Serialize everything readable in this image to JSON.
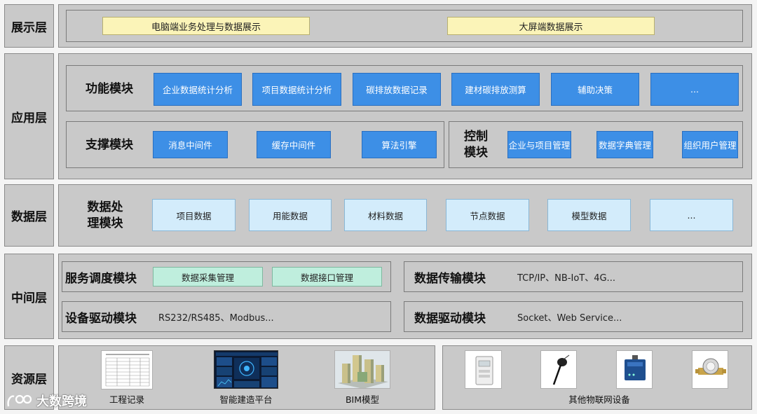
{
  "layers": {
    "display": "展示层",
    "application": "应用层",
    "data": "数据层",
    "middle": "中间层",
    "resource": "资源层"
  },
  "display": {
    "items": [
      "电脑端业务处理与数据展示",
      "大屏端数据展示"
    ]
  },
  "application": {
    "function_title": "功能模块",
    "function_items": [
      "企业数据统计分析",
      "项目数据统计分析",
      "碳排放数据记录",
      "建材碳排放测算",
      "辅助决策",
      "..."
    ],
    "support_title": "支撑模块",
    "support_items": [
      "消息中间件",
      "缓存中间件",
      "算法引擎"
    ],
    "control_title_1": "控制",
    "control_title_2": "模块",
    "control_items": [
      "企业与项目管理",
      "数据字典管理",
      "组织用户管理"
    ]
  },
  "data_layer": {
    "title_1": "数据处",
    "title_2": "理模块",
    "items": [
      "项目数据",
      "用能数据",
      "材料数据",
      "节点数据",
      "模型数据",
      "..."
    ]
  },
  "middle": {
    "scheduling_title": "服务调度模块",
    "scheduling_items": [
      "数据采集管理",
      "数据接口管理"
    ],
    "transfer_title": "数据传输模块",
    "transfer_text": "TCP/IP、NB-IoT、4G...",
    "device_title": "设备驱动模块",
    "device_text": "RS232/RS485、Modbus...",
    "datadrv_title": "数据驱动模块",
    "datadrv_text": "Socket、Web Service..."
  },
  "resource": {
    "captions": [
      "工程记录",
      "智能建造平台",
      "BIM模型",
      "其他物联网设备"
    ],
    "watermark": "大数跨境"
  },
  "colors": {
    "panel": "#c9c9c9",
    "yellow": "#fbf4b8",
    "blue": "#3d8fe6",
    "light_blue": "#d3ecfb",
    "green": "#bfeedd"
  }
}
